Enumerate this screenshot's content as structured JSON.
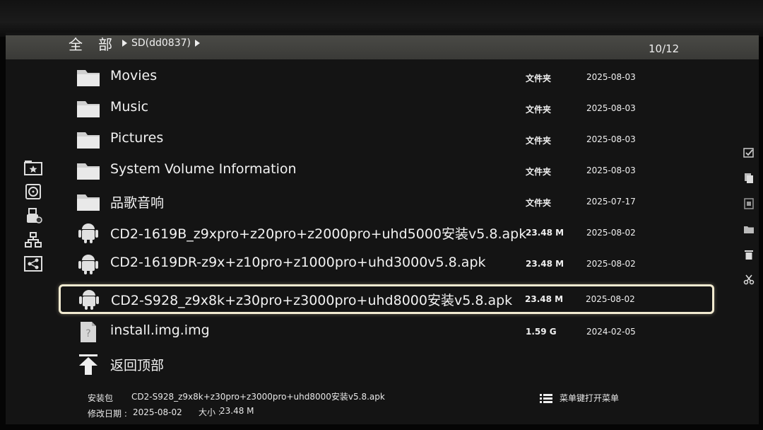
{
  "breadcrumb": {
    "root": "全部",
    "path": "SD(dd0837)"
  },
  "page_counter": "10/12",
  "files": [
    {
      "icon": "folder-icon",
      "name": "Movies",
      "type": "文件夹",
      "date": "2025-08-03"
    },
    {
      "icon": "folder-icon",
      "name": "Music",
      "type": "文件夹",
      "date": "2025-08-03"
    },
    {
      "icon": "folder-icon",
      "name": "Pictures",
      "type": "文件夹",
      "date": "2025-08-03"
    },
    {
      "icon": "folder-icon",
      "name": "System Volume Information",
      "type": "文件夹",
      "date": "2025-08-03"
    },
    {
      "icon": "folder-icon",
      "name": "品歌音响",
      "type": "文件夹",
      "date": "2025-07-17"
    },
    {
      "icon": "android-icon",
      "name": "CD2-1619B_z9xpro+z20pro+z2000pro+uhd5000安装v5.8.apk",
      "type": "23.48 M",
      "date": "2025-08-02"
    },
    {
      "icon": "android-icon",
      "name": "CD2-1619DR-z9x+z10pro+z1000pro+uhd3000v5.8.apk",
      "type": "23.48 M",
      "date": "2025-08-02"
    },
    {
      "icon": "android-icon",
      "name": "CD2-S928_z9x8k+z30pro+z3000pro+uhd8000安装v5.8.apk",
      "type": "23.48 M",
      "date": "2025-08-02",
      "selected": true
    },
    {
      "icon": "unknown-file-icon",
      "name": "install.img.img",
      "type": "1.59 G",
      "date": "2024-02-05"
    },
    {
      "icon": "back-to-top-icon",
      "name": "返回顶部",
      "type": "",
      "date": ""
    }
  ],
  "footer": {
    "type_label": "安装包",
    "selected_name": "CD2-S928_z9x8k+z30pro+z3000pro+uhd8000安装v5.8.apk",
    "modified_label": "修改日期 :",
    "modified_value": "2025-08-02",
    "size_label": "大小 :",
    "size_value": "23.48 M",
    "menu_hint": "菜单键打开菜单"
  },
  "left_rail_icons": [
    "favorites-icon",
    "disk-icon",
    "usb-icon",
    "network-icon",
    "share-icon"
  ],
  "right_rail_icons": [
    "select-icon",
    "copy-icon",
    "paste-icon",
    "new-folder-icon",
    "delete-icon",
    "cut-icon"
  ],
  "colors": {
    "topbar": "#3f3f3b",
    "selection_border": "#f1ead0",
    "folder": "#d9d9d9",
    "android": "#e0e0e0"
  }
}
